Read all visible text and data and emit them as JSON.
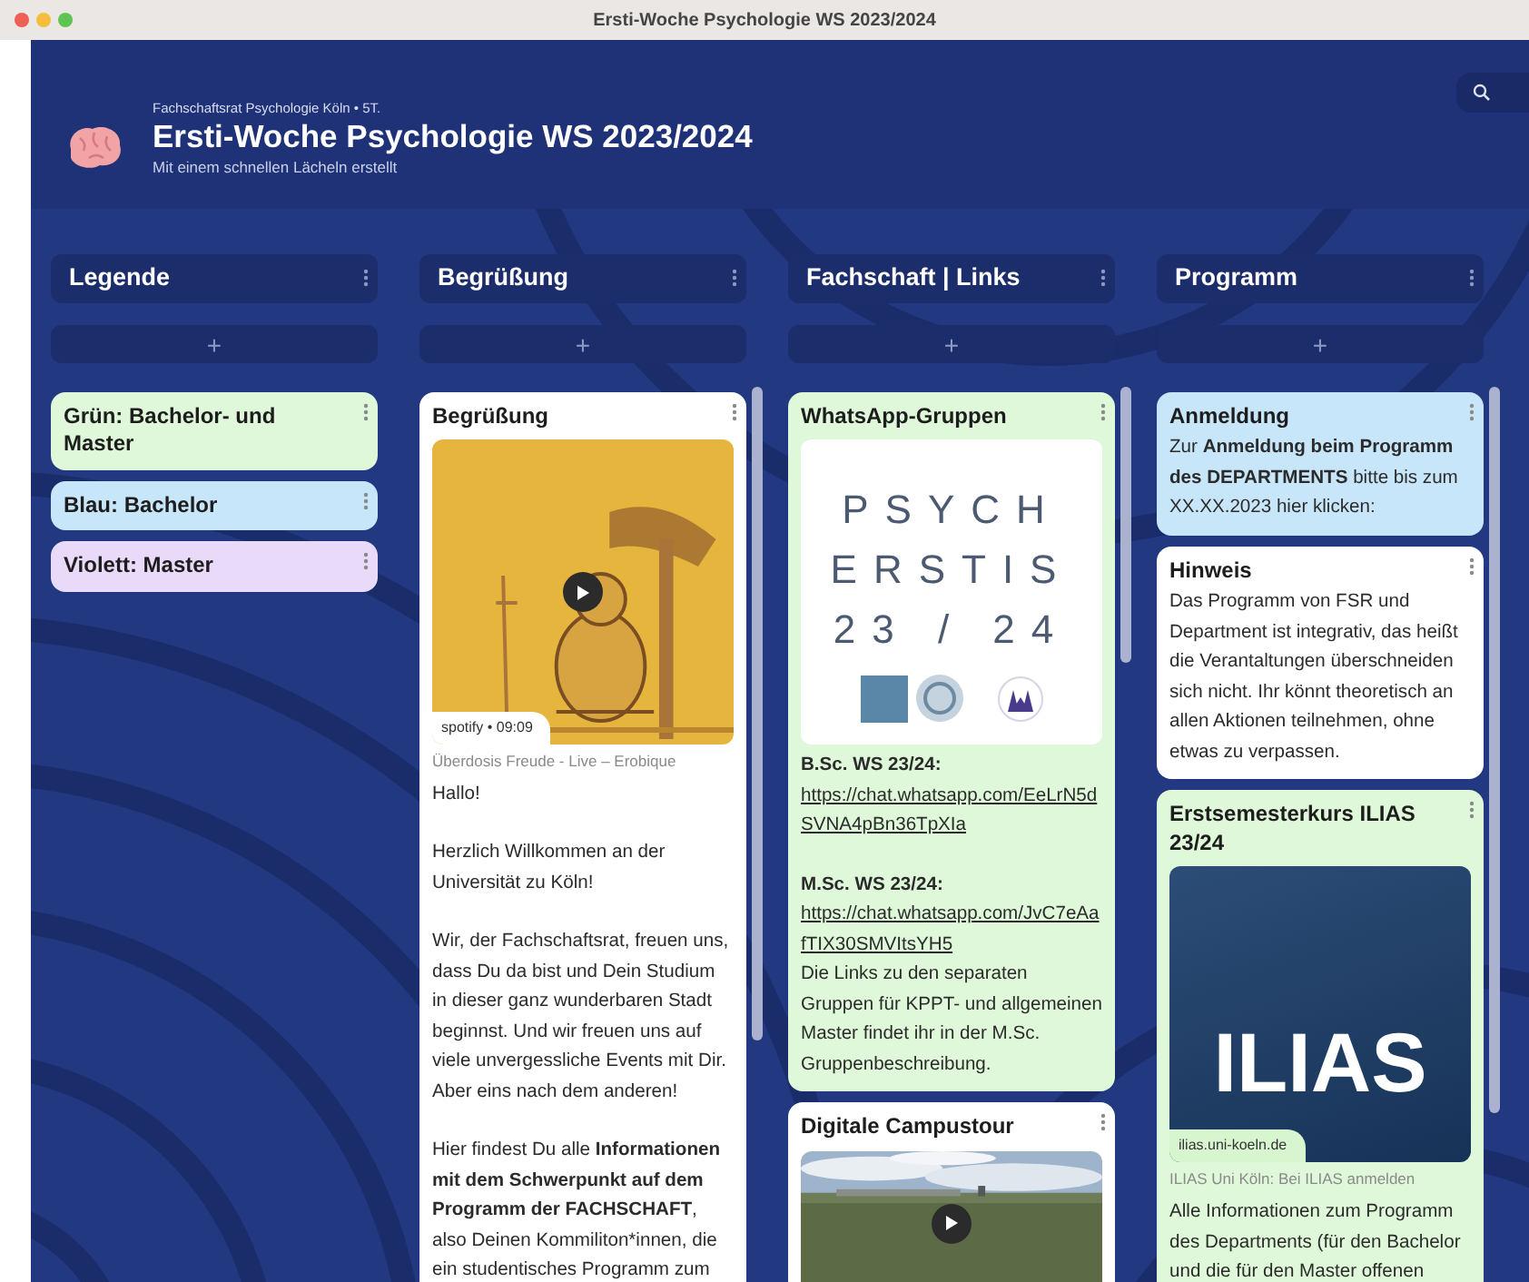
{
  "window": {
    "title": "Ersti-Woche Psychologie WS 2023/2024"
  },
  "header": {
    "owner": "Fachschaftsrat Psychologie Köln • 5T.",
    "title": "Ersti-Woche Psychologie WS 2023/2024",
    "subtitle": "Mit einem schnellen Lächeln erstellt"
  },
  "columns": [
    {
      "title": "Legende",
      "add": "+",
      "scrollable": false,
      "posts": [
        {
          "title": "Grün: Bachelor- und Master",
          "color": "#dff8d9"
        },
        {
          "title": "Blau: Bachelor",
          "color": "#c8e6fa"
        },
        {
          "title": "Violett: Master",
          "color": "#e9dafa"
        }
      ]
    },
    {
      "title": "Begrüßung",
      "add": "+",
      "scrollable": true,
      "posts": [
        {
          "title": "Begrüßung",
          "color": "#ffffff",
          "attachment": {
            "kind": "audio",
            "badge": "spotify • 09:09",
            "caption": "Überdosis Freude - Live – Erobique"
          },
          "body": [
            [
              {
                "kind": "text",
                "text": "Hallo!"
              }
            ],
            [
              {
                "kind": "text",
                "text": "Herzlich Willkommen an der Universität zu Köln!"
              }
            ],
            [
              {
                "kind": "text",
                "text": "Wir, der Fachschaftsrat, freuen uns, dass Du da bist und Dein Studium in dieser ganz wunderbaren Stadt beginnst. Und wir freuen uns auf viele unvergessliche Events mit Dir. Aber eins nach dem anderen!"
              }
            ],
            [
              {
                "kind": "text",
                "text": "Hier findest Du alle **Informationen mit dem Schwerpunkt auf dem Programm der FACHSCHAFT**, also Deinen Kommiliton*innen, die ein studentisches Programm zum"
              }
            ]
          ]
        }
      ]
    },
    {
      "title": "Fachschaft | Links",
      "add": "+",
      "scrollable": true,
      "posts": [
        {
          "title": "WhatsApp-Gruppen",
          "color": "#dff8d9",
          "attachment": {
            "kind": "graphic",
            "lines": [
              "PSYCH",
              "ERSTIS",
              "23 / 24"
            ]
          },
          "body": [
            [
              {
                "kind": "label",
                "text": "B.Sc. WS 23/24:"
              },
              {
                "kind": "link",
                "text": "https://chat.whatsapp.com/EeLrN5dSVNA4pBn36TpXIa"
              }
            ],
            [
              {
                "kind": "label",
                "text": "M.Sc. WS 23/24:"
              },
              {
                "kind": "link",
                "text": "https://chat.whatsapp.com/JvC7eAafTIX30SMVItsYH5"
              },
              {
                "kind": "text",
                "text": "Die Links zu den separaten Gruppen für KPPT- und allgemeinen Master findet ihr in der  M.Sc. Gruppenbeschreibung."
              }
            ]
          ]
        },
        {
          "title": "Digitale Campustour",
          "color": "#ffffff",
          "attachment": {
            "kind": "video"
          }
        }
      ]
    },
    {
      "title": "Programm",
      "add": "+",
      "scrollable": true,
      "posts": [
        {
          "title": "Anmeldung",
          "color": "#c8e6fa",
          "body": [
            [
              {
                "kind": "text",
                "text": "Zur **Anmeldung beim Programm des DEPARTMENTS** bitte bis zum XX.XX.2023 hier klicken:"
              }
            ]
          ]
        },
        {
          "title": "Hinweis",
          "color": "#ffffff",
          "body": [
            [
              {
                "kind": "text",
                "text": "Das Programm von FSR und Department ist integrativ, das heißt die Verantaltungen überschneiden sich nicht. Ihr könnt theoretisch an allen Aktionen teilnehmen, ohne etwas zu verpassen."
              }
            ]
          ]
        },
        {
          "title": "Erstsemesterkurs ILIAS 23/24",
          "color": "#dff8d9",
          "attachment": {
            "kind": "link",
            "headline": "ILIAS",
            "badge": "ilias.uni-koeln.de",
            "caption": "ILIAS Uni Köln: Bei ILIAS anmelden"
          },
          "body": [
            [
              {
                "kind": "text",
                "text": "Alle Informationen zum Programm des Departments (für den Bachelor und die für den Master offenen"
              }
            ]
          ]
        }
      ]
    }
  ]
}
